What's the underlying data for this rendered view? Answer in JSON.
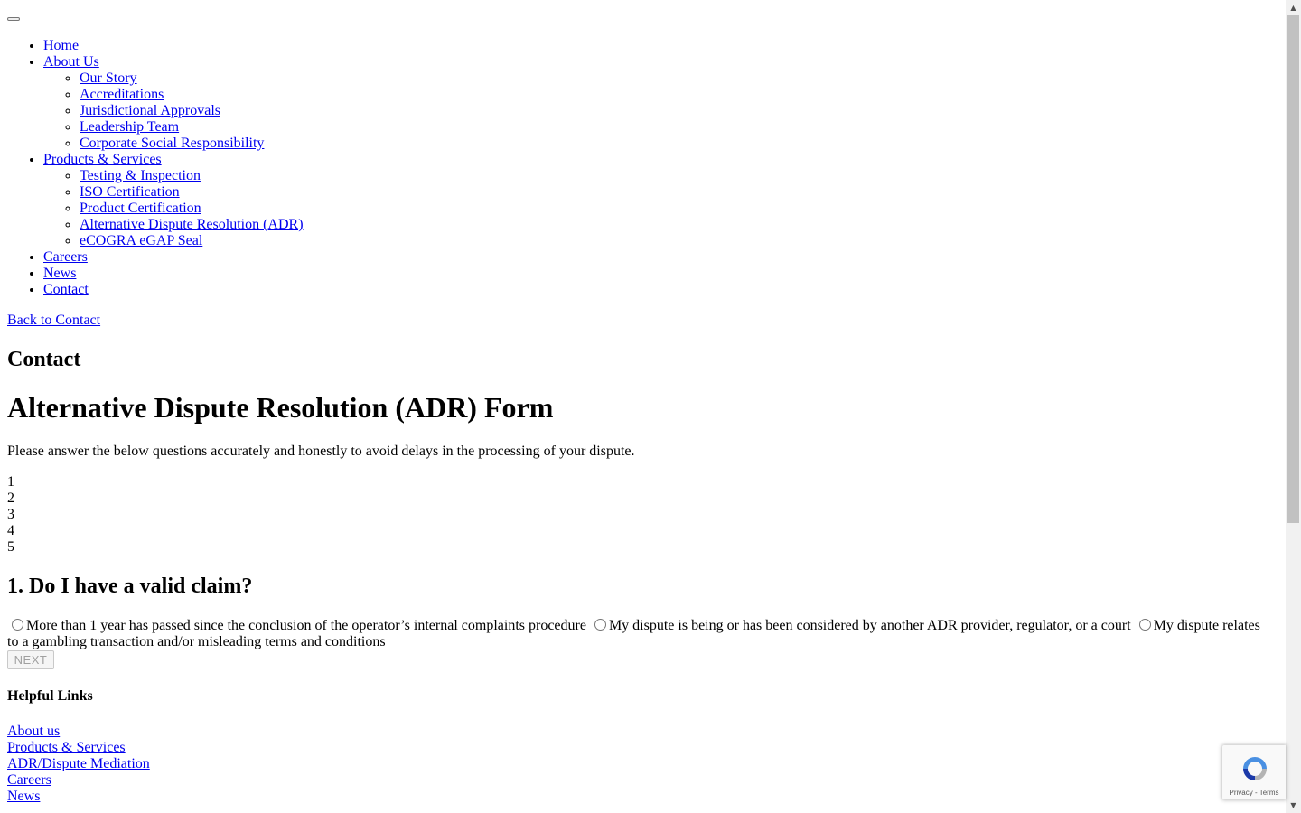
{
  "nav": {
    "items": [
      {
        "label": "Home"
      },
      {
        "label": "About Us",
        "children": [
          {
            "label": "Our Story"
          },
          {
            "label": "Accreditations"
          },
          {
            "label": "Jurisdictional Approvals"
          },
          {
            "label": "Leadership Team"
          },
          {
            "label": "Corporate Social Responsibility"
          }
        ]
      },
      {
        "label": "Products & Services",
        "children": [
          {
            "label": "Testing & Inspection"
          },
          {
            "label": "ISO Certification"
          },
          {
            "label": "Product Certification"
          },
          {
            "label": "Alternative Dispute Resolution (ADR)"
          },
          {
            "label": "eCOGRA eGAP Seal"
          }
        ]
      },
      {
        "label": "Careers"
      },
      {
        "label": "News"
      },
      {
        "label": "Contact"
      }
    ]
  },
  "back_link": "Back to Contact",
  "section_heading": "Contact",
  "form": {
    "title": "Alternative Dispute Resolution (ADR) Form",
    "intro": "Please answer the below questions accurately and honestly to avoid delays in the processing of your dispute.",
    "steps": [
      "1",
      "2",
      "3",
      "4",
      "5"
    ],
    "question": "1. Do I have a valid claim?",
    "options": [
      "More than 1 year has passed since the conclusion of the operator’s internal complaints procedure",
      "My dispute is being or has been considered by another ADR provider, regulator, or a court",
      "My dispute relates to a gambling transaction and/or misleading terms and conditions"
    ],
    "next_label": "NEXT"
  },
  "footer": {
    "heading": "Helpful Links",
    "links": [
      "About us",
      "Products & Services",
      "ADR/Dispute Mediation",
      "Careers",
      "News"
    ]
  },
  "recaptcha": {
    "terms_text": "Privacy - Terms"
  },
  "colors": {
    "link": "#0000ee",
    "scrollbar_track": "#f1f1f1",
    "scrollbar_thumb": "#c1c1c1"
  }
}
